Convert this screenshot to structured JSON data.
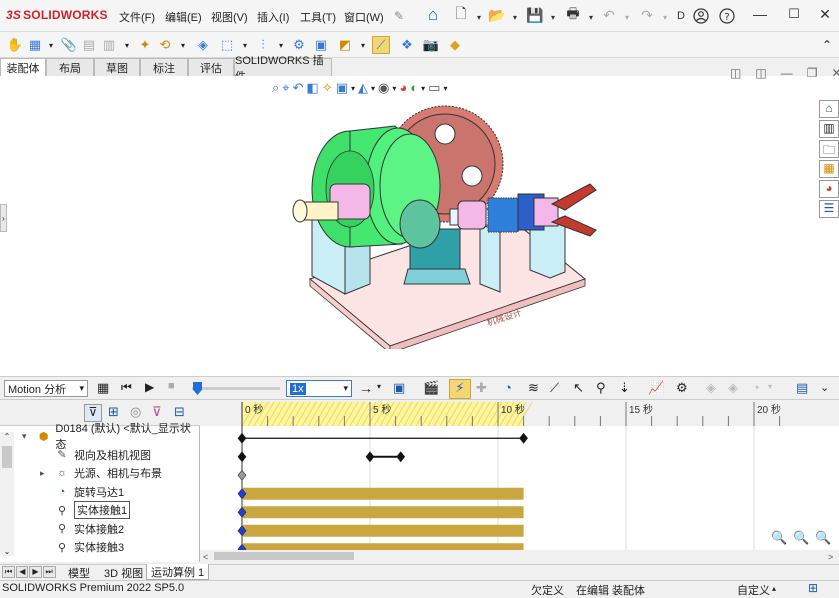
{
  "app": {
    "logo_text": "SOLIDWORKS",
    "logo_prefix": "3S"
  },
  "menu": [
    "文件(F)",
    "编辑(E)",
    "视图(V)",
    "插入(I)",
    "工具(T)",
    "窗口(W)"
  ],
  "toolbar": {
    "more_label": "D"
  },
  "tabs": [
    "装配体",
    "布局",
    "草图",
    "标注",
    "评估",
    "SOLIDWORKS 插件"
  ],
  "viewport": {
    "watermark": "机械设计"
  },
  "motion": {
    "study_type": "Motion 分析",
    "speed": "1x",
    "ruler_ticks": [
      {
        "label": "0 秒",
        "t": 0
      },
      {
        "label": "5 秒",
        "t": 5
      },
      {
        "label": "10 秒",
        "t": 10
      },
      {
        "label": "15 秒",
        "t": 15
      },
      {
        "label": "20 秒",
        "t": 20
      }
    ],
    "playhead_seconds": 0,
    "tree": [
      {
        "label": "D0184 (默认) <默认_显示状态",
        "icon": "assembly-icon",
        "indent": 0,
        "expander": "▾"
      },
      {
        "label": "视向及相机视图",
        "icon": "camera-view-icon",
        "indent": 1,
        "expander": ""
      },
      {
        "label": "光源、相机与布景",
        "icon": "lights-cameras-icon",
        "indent": 1,
        "expander": "▸"
      },
      {
        "label": "旋转马达1",
        "icon": "rotary-motor-icon",
        "indent": 1,
        "expander": ""
      },
      {
        "label": "实体接触1",
        "icon": "contact-icon",
        "indent": 1,
        "expander": "",
        "selected": true
      },
      {
        "label": "实体接触2",
        "icon": "contact-icon",
        "indent": 1,
        "expander": ""
      },
      {
        "label": "实体接触3",
        "icon": "contact-icon",
        "indent": 1,
        "expander": ""
      }
    ]
  },
  "bottom_tabs": [
    "模型",
    "3D 视图",
    "运动算例 1"
  ],
  "status": {
    "product": "SOLIDWORKS Premium 2022 SP5.0",
    "under_defined": "欠定义",
    "editing": "在编辑 装配体",
    "custom": "自定义"
  },
  "colors": {
    "accent": "#1e6fd9",
    "bar": "#c9a640",
    "highlight": "#fff59d",
    "brand": "#d0202a"
  }
}
